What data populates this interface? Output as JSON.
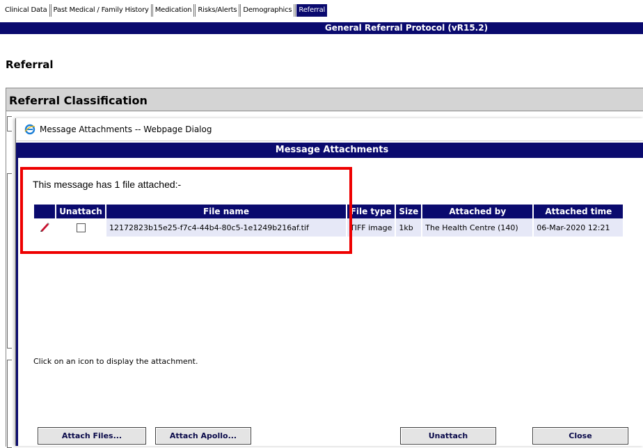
{
  "tabs": [
    {
      "label": "Clinical Data",
      "active": false
    },
    {
      "label": "Past Medical / Family History",
      "active": false
    },
    {
      "label": "Medication",
      "active": false
    },
    {
      "label": "Risks/Alerts",
      "active": false
    },
    {
      "label": "Demographics",
      "active": false
    },
    {
      "label": "Referral",
      "active": true
    }
  ],
  "protocol_title": "General Referral Protocol (vR15.2)",
  "section_title": "Referral",
  "classification_title": "Referral Classification",
  "dialog": {
    "window_title": "Message Attachments -- Webpage Dialog",
    "header": "Message Attachments",
    "message": "This message has 1 file attached:-",
    "columns": [
      "Unattach",
      "File name",
      "File type",
      "Size",
      "Attached by",
      "Attached time"
    ],
    "rows": [
      {
        "icon": "pencil-icon",
        "unattach_checked": false,
        "file_name": "12172823b15e25-f7c4-44b4-80c5-1e1249b216af.tif",
        "file_type": "TIFF image",
        "size": "1kb",
        "attached_by": "The Health Centre (140)",
        "attached_time": "06-Mar-2020 12:21"
      }
    ],
    "hint": "Click on an icon to display the attachment.",
    "buttons": {
      "attach_files": "Attach Files...",
      "attach_apollo": "Attach Apollo...",
      "unattach": "Unattach",
      "close": "Close"
    }
  },
  "colors": {
    "navy": "#0a0a6e",
    "row_bg": "#e6e8f7",
    "highlight": "#ee0000"
  }
}
